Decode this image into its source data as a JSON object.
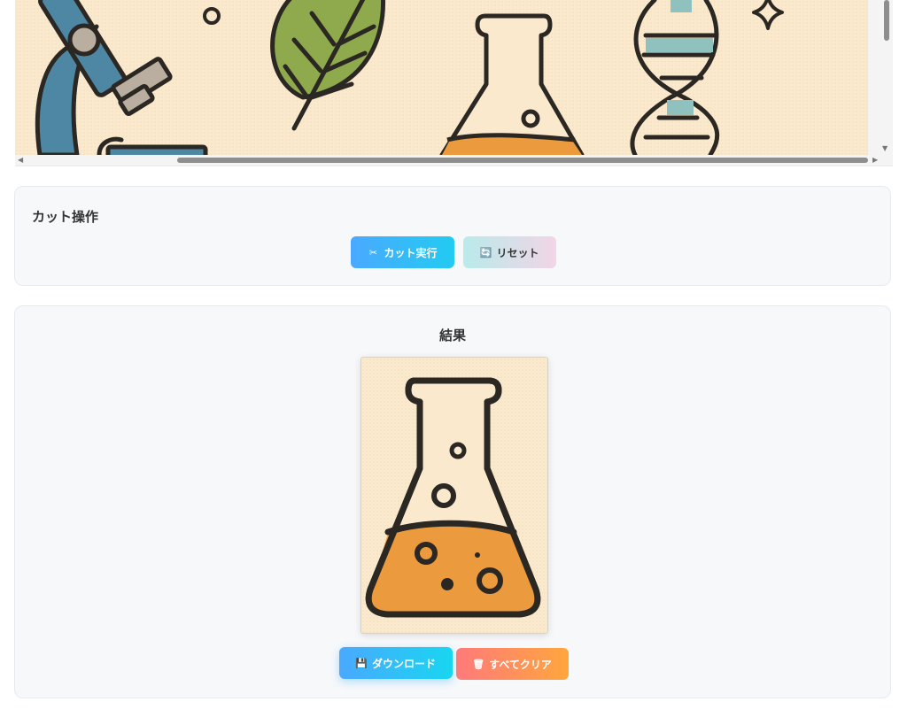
{
  "viewer": {
    "icons": [
      "microscope-icon",
      "leaf-icon",
      "flask-icon",
      "dna-icon",
      "sparkle-icon"
    ]
  },
  "cut_panel": {
    "title": "カット操作",
    "cut_button": {
      "icon": "scissors-icon",
      "glyph": "✂",
      "label": "カット実行"
    },
    "reset_button": {
      "icon": "refresh-icon",
      "glyph": "🔄",
      "label": "リセット"
    }
  },
  "result_panel": {
    "title": "結果",
    "image_icon": "flask-icon",
    "download_button": {
      "icon": "floppy-disk-icon",
      "glyph": "💾",
      "label": "ダウンロード"
    },
    "clear_button": {
      "icon": "trash-icon",
      "glyph": "🗑",
      "label": "すべてクリア"
    }
  },
  "colors": {
    "canvas_bg": "#fbe9cd",
    "outline": "#2b2722",
    "liquid": "#ec9a3e",
    "leaf": "#8fa94d",
    "microscope": "#4d87a3",
    "dna_band": "#8fc1bf",
    "accent_blue": "#22cbf2",
    "accent_orange": "#ffa63d"
  }
}
